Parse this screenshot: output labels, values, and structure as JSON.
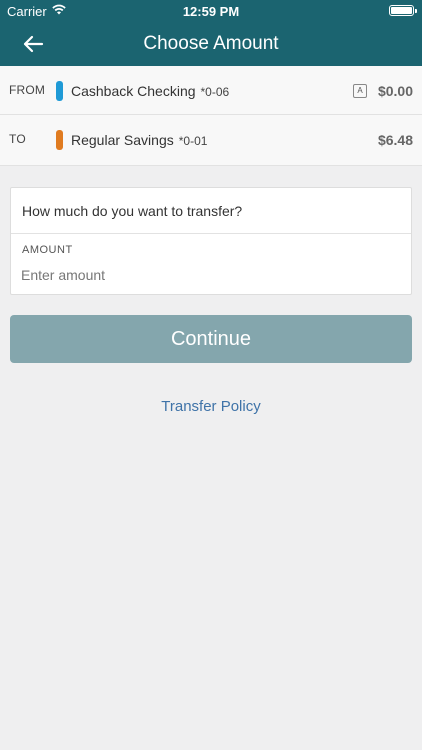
{
  "status_bar": {
    "carrier": "Carrier",
    "time": "12:59 PM"
  },
  "nav": {
    "title": "Choose Amount",
    "back_icon": "arrow-left-icon"
  },
  "accounts": {
    "from": {
      "role": "FROM",
      "name": "Cashback Checking",
      "number": "*0-06",
      "badge": "A",
      "balance": "$0.00",
      "color": "#1f9ad6"
    },
    "to": {
      "role": "TO",
      "name": "Regular Savings",
      "number": "*0-01",
      "balance": "$6.48",
      "color": "#e07b20"
    }
  },
  "amount": {
    "question": "How much do you want to transfer?",
    "label": "AMOUNT",
    "placeholder": "Enter amount",
    "value": ""
  },
  "actions": {
    "continue_label": "Continue",
    "policy_link": "Transfer Policy"
  },
  "colors": {
    "header": "#1b6470",
    "button_disabled": "#84a6ad",
    "link": "#3f73a8"
  }
}
